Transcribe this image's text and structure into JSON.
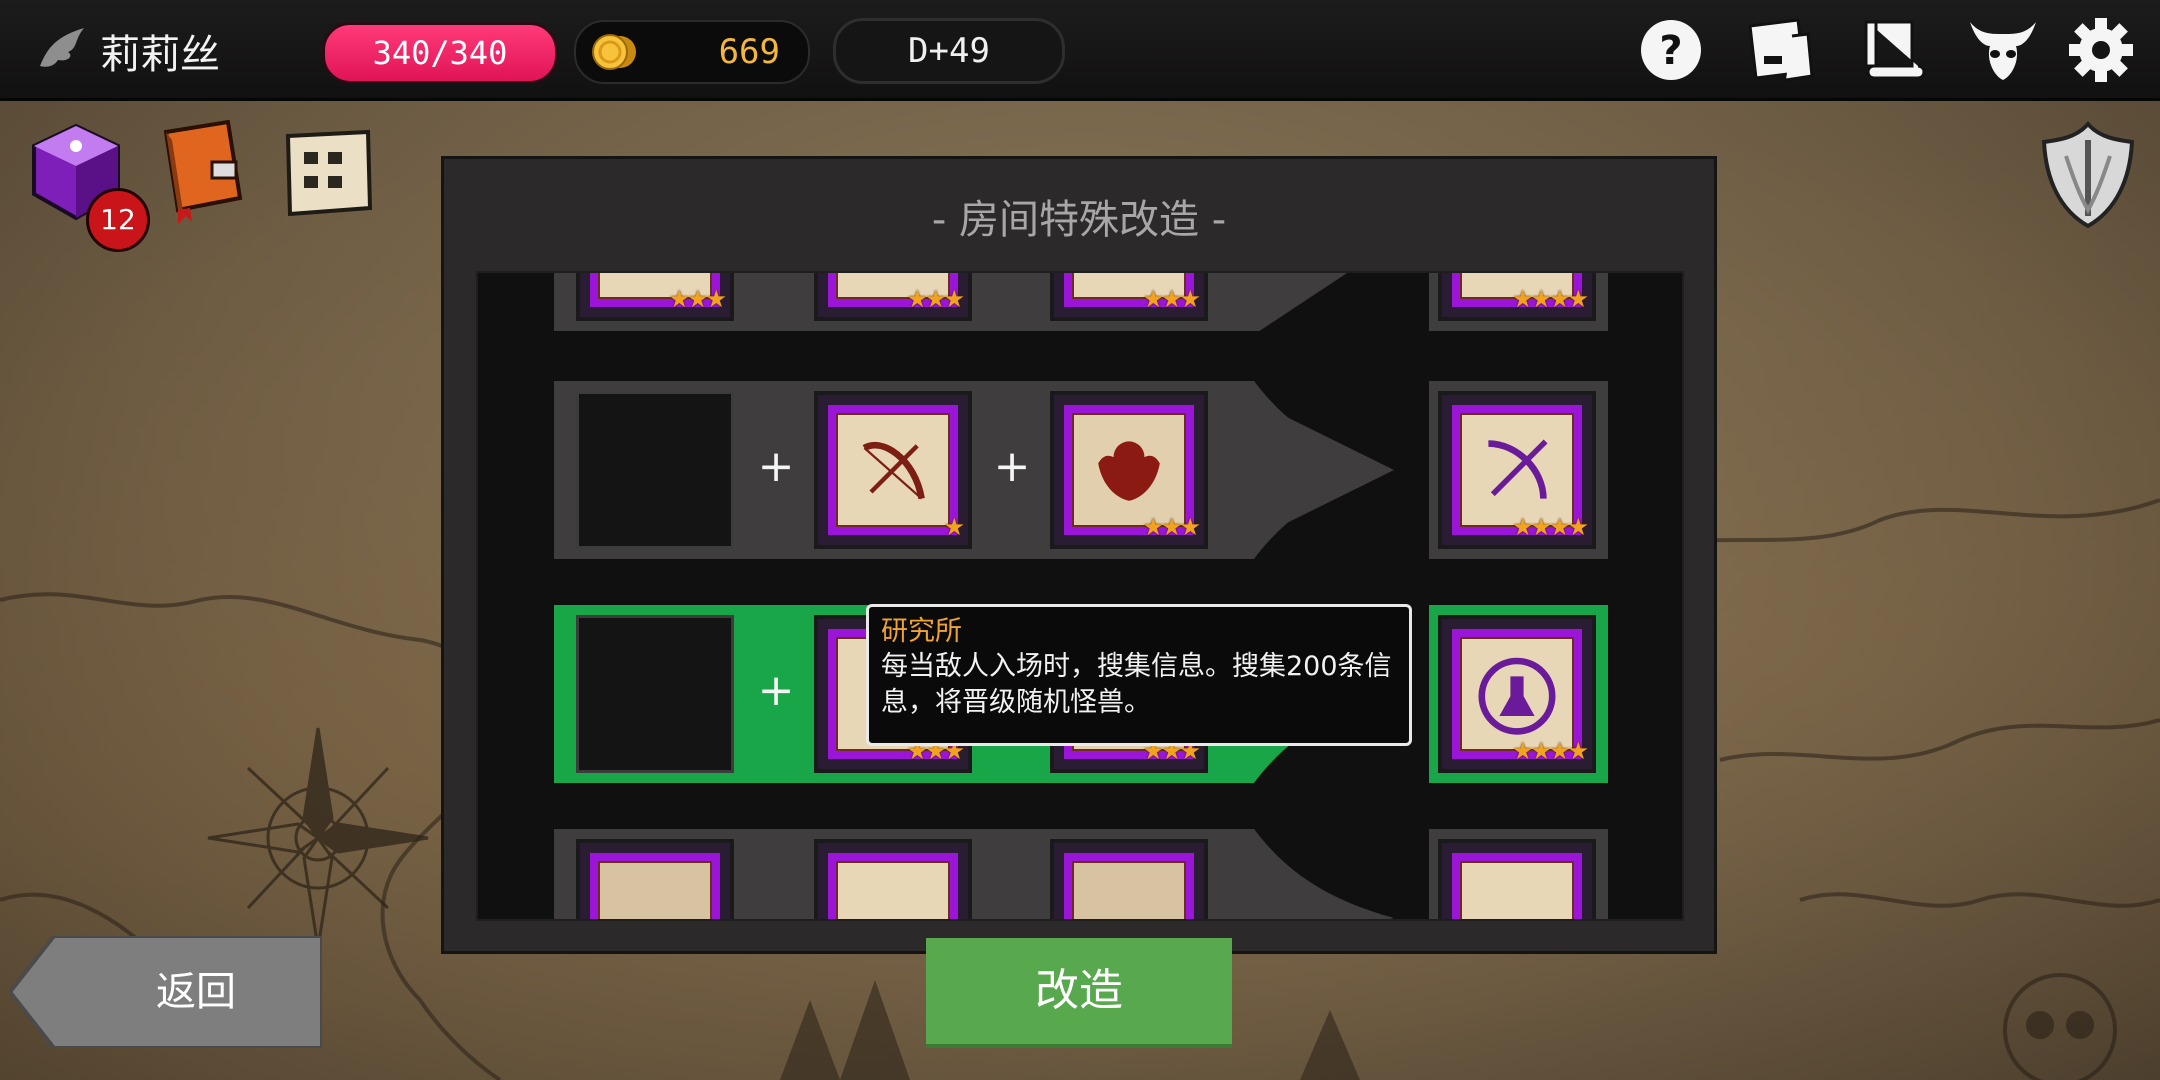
{
  "player": {
    "name": "莉莉丝"
  },
  "stats": {
    "hp": "340/340",
    "gold": "669",
    "day": "D+49"
  },
  "inventory": {
    "badge_count": "12"
  },
  "dialog": {
    "title": "- 房间特殊改造 -",
    "rows": [
      {
        "id": "row-partial-top",
        "stars": [
          "★★★",
          "★★★",
          "★★★",
          "★★★★"
        ]
      },
      {
        "id": "row-1",
        "slots": [
          "empty",
          "bow",
          "monster"
        ],
        "stars": [
          "",
          "★",
          "★★★"
        ],
        "result_stars": "★★★★"
      },
      {
        "id": "row-2",
        "selected": true,
        "slots": [
          "empty",
          "research",
          "monster"
        ],
        "stars": [
          "",
          "★★★",
          "★★★"
        ],
        "result_stars": "★★★★"
      },
      {
        "id": "row-partial-bottom"
      }
    ],
    "plus": "+"
  },
  "tooltip": {
    "title": "研究所",
    "body": "每当敌人入场时，搜集信息。搜集200条信息，将晋级随机怪兽。"
  },
  "buttons": {
    "back": "返回",
    "modify": "改造"
  },
  "colors": {
    "hp": "#ff2d6f",
    "gold": "#f4b73b",
    "selected_row": "#18a648",
    "card_frame": "#9b15d8",
    "modify_button": "#58a84d"
  },
  "icons": [
    "bat-wing-icon",
    "coin-icon",
    "help-icon",
    "card-deck-icon",
    "scroll-icon",
    "demon-horns-icon",
    "gear-icon",
    "dice-icon",
    "book-icon",
    "map-scroll-icon",
    "shield-emblem-icon"
  ]
}
